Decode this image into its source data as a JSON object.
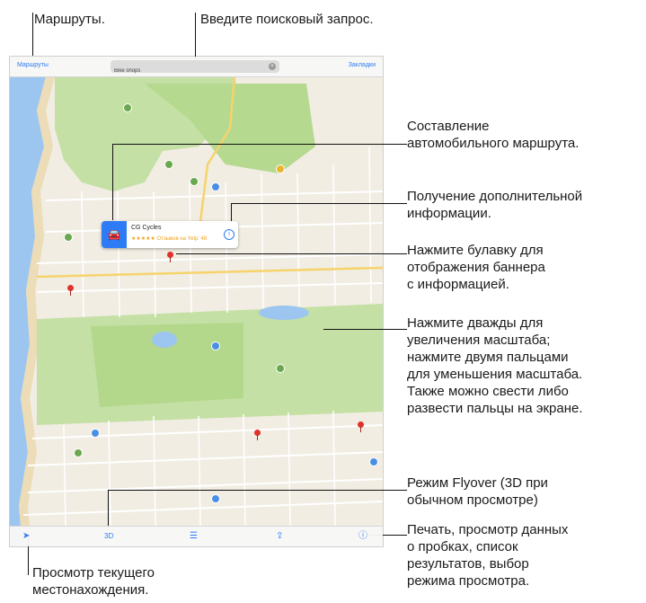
{
  "annotations": {
    "routes": "Маршруты.",
    "search": "Введите поисковый запрос.",
    "directions": "Составление\nавтомобильного маршрута.",
    "info": "Получение дополнительной\nинформации.",
    "pin": "Нажмите булавку для\nотображения баннера\nс информацией.",
    "zoom": "Нажмите дважды для\nувеличения масштаба;\nнажмите двумя пальцами\nдля уменьшения масштаба.\nТакже можно свести либо\nразвести пальцы на экране.",
    "flyover": "Режим Flyover (3D при\nобычном просмотре)",
    "options": "Печать, просмотр данных\nо пробках, список\nрезультатов, выбор\nрежима просмотра.",
    "location": "Просмотр текущего\nместонахождения."
  },
  "map": {
    "routes_link": "Маршруты",
    "search_value": "Bike shops",
    "favorites_link": "Закладки",
    "callout_title": "CG Cycles",
    "callout_subtitle": "★★★★★  Отзывов на Yelp: 48",
    "toolbar": {
      "location_icon": "location-arrow-icon",
      "threed_label": "3D",
      "list_icon": "list-icon",
      "share_icon": "share-icon",
      "info_icon": "info-icon"
    }
  },
  "colors": {
    "accent": "#2d7cf6",
    "park": "#c5e0a5",
    "water": "#9cc6ef",
    "land": "#f1ede3",
    "pin": "#e0322b"
  }
}
